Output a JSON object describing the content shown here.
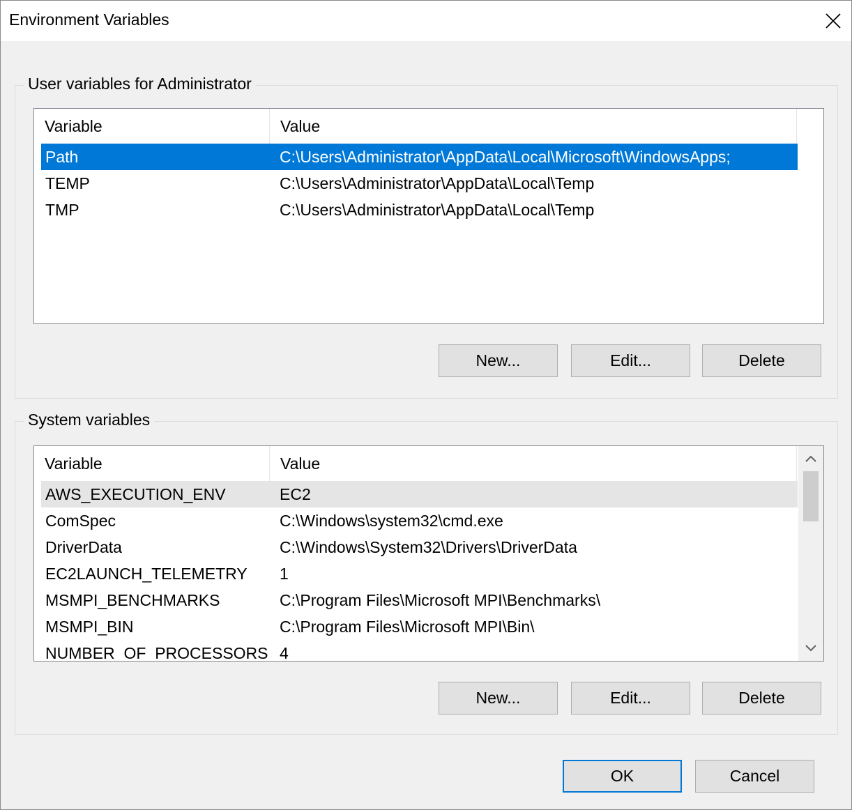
{
  "window": {
    "title": "Environment Variables"
  },
  "user_section": {
    "legend": "User variables for Administrator",
    "columns": {
      "variable": "Variable",
      "value": "Value"
    },
    "rows": [
      {
        "variable": "Path",
        "value": "C:\\Users\\Administrator\\AppData\\Local\\Microsoft\\WindowsApps;"
      },
      {
        "variable": "TEMP",
        "value": "C:\\Users\\Administrator\\AppData\\Local\\Temp"
      },
      {
        "variable": "TMP",
        "value": "C:\\Users\\Administrator\\AppData\\Local\\Temp"
      }
    ],
    "selected_row": "Path",
    "buttons": {
      "new": "New...",
      "edit": "Edit...",
      "delete": "Delete"
    }
  },
  "system_section": {
    "legend": "System variables",
    "columns": {
      "variable": "Variable",
      "value": "Value"
    },
    "rows": [
      {
        "variable": "AWS_EXECUTION_ENV",
        "value": "EC2"
      },
      {
        "variable": "ComSpec",
        "value": "C:\\Windows\\system32\\cmd.exe"
      },
      {
        "variable": "DriverData",
        "value": "C:\\Windows\\System32\\Drivers\\DriverData"
      },
      {
        "variable": "EC2LAUNCH_TELEMETRY",
        "value": "1"
      },
      {
        "variable": "MSMPI_BENCHMARKS",
        "value": "C:\\Program Files\\Microsoft MPI\\Benchmarks\\"
      },
      {
        "variable": "MSMPI_BIN",
        "value": "C:\\Program Files\\Microsoft MPI\\Bin\\"
      },
      {
        "variable": "NUMBER_OF_PROCESSORS",
        "value": "4"
      }
    ],
    "highlighted_row": "AWS_EXECUTION_ENV",
    "buttons": {
      "new": "New...",
      "edit": "Edit...",
      "delete": "Delete"
    }
  },
  "footer": {
    "ok": "OK",
    "cancel": "Cancel"
  },
  "icons": {
    "close": "close-icon",
    "scroll_up": "chevron-up-icon",
    "scroll_down": "chevron-down-icon"
  },
  "colors": {
    "selection": "#0078d7",
    "hover_row": "#e5e5e5",
    "dialog_bg": "#f0f0f0"
  }
}
